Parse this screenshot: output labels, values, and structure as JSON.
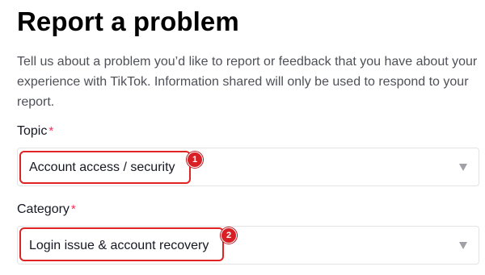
{
  "page": {
    "title": "Report a problem",
    "description": "Tell us about a problem you’d like to report or feedback that you have about your experience with TikTok. Information shared will only be used to respond to your report."
  },
  "topic": {
    "label": "Topic",
    "required_mark": "*",
    "selected_value": "Account access / security"
  },
  "category": {
    "label": "Category",
    "required_mark": "*",
    "selected_value": "Login issue & account recovery"
  },
  "annotations": {
    "marker_1": "1",
    "marker_2": "2",
    "highlight_color": "#e02424"
  },
  "colors": {
    "required": "#fe2c55",
    "text": "#161823",
    "muted_text": "#4f5058"
  },
  "icons": {
    "dropdown": "caret-down-icon"
  }
}
